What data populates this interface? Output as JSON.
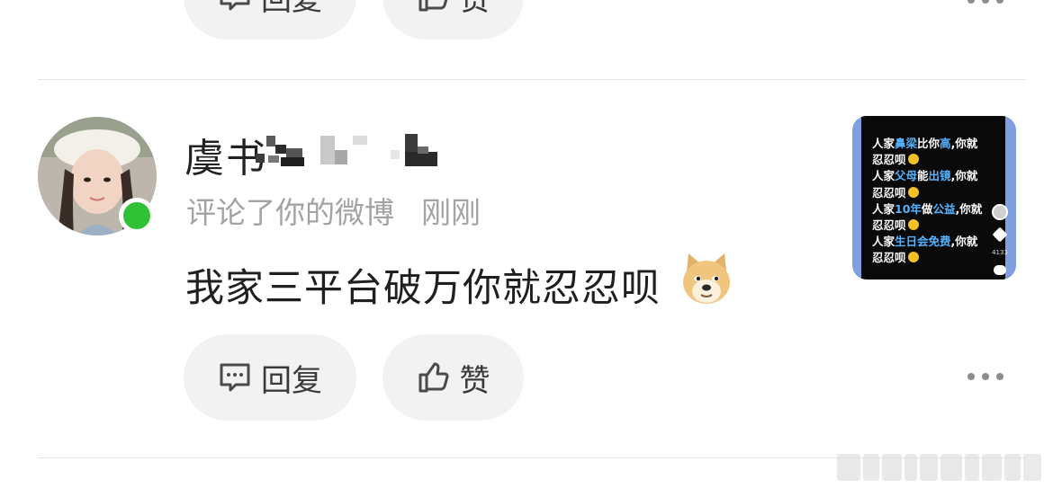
{
  "prev_item": {
    "reply_label": "回复",
    "like_label": "赞"
  },
  "notification": {
    "username": "虞书",
    "action": "评论了你的微博",
    "time": "刚刚",
    "comment": "我家三平台破万你就忍忍呗",
    "emoji": "doge-icon",
    "online_color": "#2fc236",
    "thumbnail": {
      "lines": [
        [
          {
            "t": "人家"
          },
          {
            "t": "鼻梁",
            "hl": true
          },
          {
            "t": "比你"
          },
          {
            "t": "高",
            "hl": true
          },
          {
            "t": ",你就"
          }
        ],
        [
          {
            "t": "忍忍呗"
          },
          {
            "emoji": true
          }
        ],
        [
          {
            "t": "人家"
          },
          {
            "t": "父母",
            "hl": true
          },
          {
            "t": "能"
          },
          {
            "t": "出镜",
            "hl": true
          },
          {
            "t": ",你就"
          }
        ],
        [
          {
            "t": "忍忍呗"
          },
          {
            "emoji": true
          }
        ],
        [
          {
            "t": "人家"
          },
          {
            "t": "10年",
            "hl": true
          },
          {
            "t": "做"
          },
          {
            "t": "公益",
            "hl": true
          },
          {
            "t": ",你就"
          }
        ],
        [
          {
            "t": "忍忍呗"
          },
          {
            "emoji": true
          }
        ],
        [
          {
            "t": "人家"
          },
          {
            "t": "生日会免费",
            "hl": true
          },
          {
            "t": ",你就"
          }
        ],
        [
          {
            "t": "忍忍呗"
          },
          {
            "emoji": true
          }
        ]
      ],
      "side_count": "4133",
      "accent": "#54b3ff",
      "frame_color": "#7f9fe0"
    },
    "actions": {
      "reply_label": "回复",
      "like_label": "赞"
    }
  }
}
